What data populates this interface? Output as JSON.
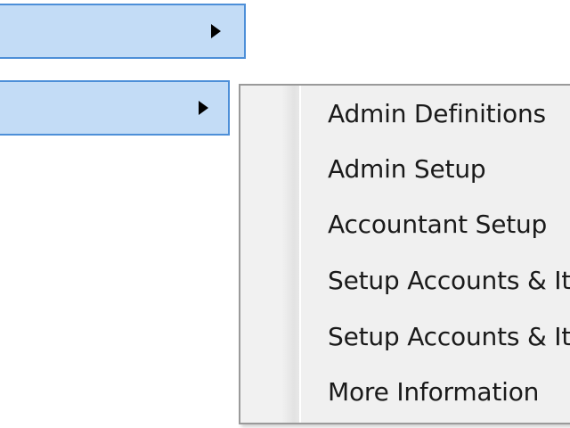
{
  "parent_menu": {
    "rows": [
      {
        "state": "hover",
        "has_submenu": true
      },
      {
        "state": "active",
        "has_submenu": true
      }
    ],
    "highlight_fill": "#c3dcf6",
    "highlight_border": "#4d8fd8",
    "arrow_icon": "submenu-arrow-right-icon"
  },
  "submenu": {
    "background": "#f0f0f0",
    "border": "#9a9a9a",
    "items": [
      {
        "label": "Admin Definitions"
      },
      {
        "label": "Admin Setup"
      },
      {
        "label": "Accountant Setup"
      },
      {
        "label": "Setup Accounts & It"
      },
      {
        "label": "Setup Accounts & It"
      },
      {
        "label": "More Information"
      }
    ]
  }
}
